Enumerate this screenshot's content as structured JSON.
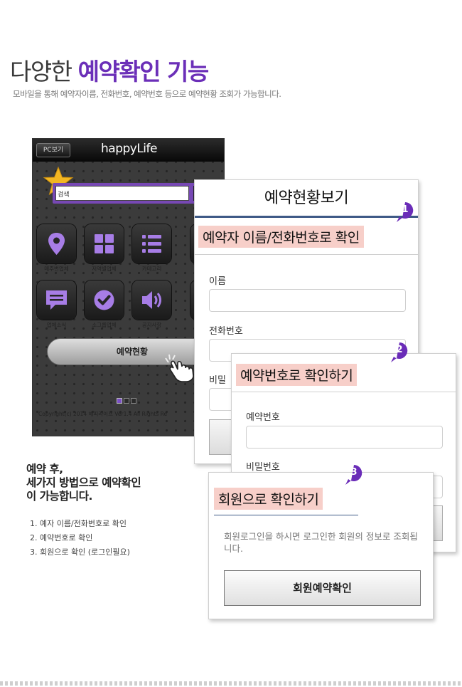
{
  "header": {
    "title_plain": "다양한",
    "title_highlight": "예약확인 기능",
    "subtitle": "모바일을 통해 예약자이름, 전화번호, 예약번호 등으로 예약현황 조회가 가능합니다."
  },
  "phone": {
    "pc_button": "PC보기",
    "logo": "happyLife",
    "search_value": "검색",
    "tiles": [
      {
        "icon": "location-pin-icon",
        "label": "매주번업체"
      },
      {
        "icon": "grid-icon",
        "label": "저역별업체"
      },
      {
        "icon": "list-icon",
        "label": "카테고리"
      },
      {
        "icon": "chat-icon",
        "label": "업체소식"
      },
      {
        "icon": "check-icon",
        "label": "소그룹업체"
      },
      {
        "icon": "speaker-icon",
        "label": "공지사항"
      }
    ],
    "reservation_button": "예약현황",
    "copyright": "Copyright(c) 2014 해피라이프 Ver1.4   All Rights Re"
  },
  "panel1": {
    "title": "예약현황보기",
    "badge": "1",
    "tag": "예약자 이름/전화번호로 확인",
    "name_label": "이름",
    "phone_label": "전화번호",
    "password_label_partial": "비밀"
  },
  "panel2": {
    "badge": "2",
    "tag": "예약번호로 확인하기",
    "number_label": "예약번호",
    "password_label": "비밀번호"
  },
  "panel3": {
    "badge": "3",
    "tag": "회원으로 확인하기",
    "description": "회원로그인을 하시면 로그인한 회원의 정보로 조회됩니다.",
    "button": "회원예약확인"
  },
  "notes": {
    "heading": [
      "예약 후,",
      "세가지 방법으로 예약확인",
      "이 가능합니다."
    ],
    "items": [
      "1. 예자 이름/전화번호로 확인",
      "2. 예약번호로 확인",
      "3. 회원으로 확인 (로그인필요)"
    ]
  },
  "colors": {
    "accent_purple": "#6b2fb8",
    "tile_icon": "#a77de6",
    "tag_bg": "#f7cfc9",
    "title_rule": "#3e5a86",
    "badge": "#6a2cb8"
  }
}
